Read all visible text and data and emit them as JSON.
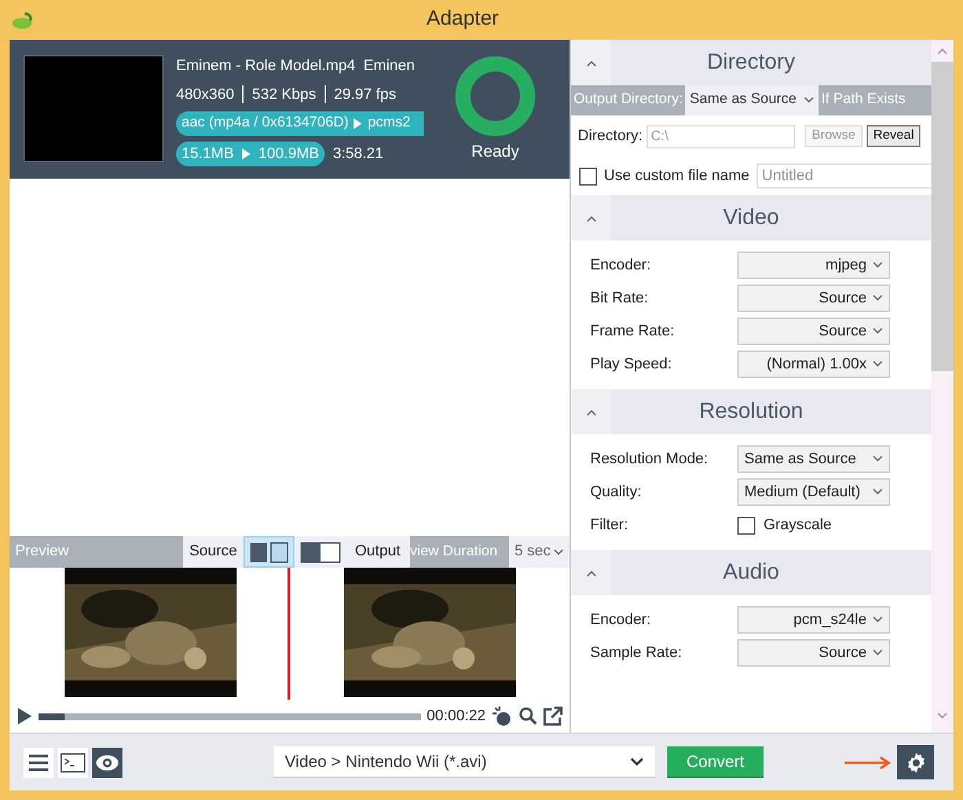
{
  "window": {
    "title": "Adapter"
  },
  "file": {
    "name": "Eminem - Role Model.mp4",
    "name_extra": "Eminen",
    "resolution": "480x360",
    "bitrate": "532 Kbps",
    "fps": "29.97 fps",
    "audio_in": "aac (mp4a / 0x6134706D)",
    "audio_out": "pcms2",
    "size_in": "15.1MB",
    "size_out": "100.9MB",
    "duration": "3:58.21",
    "status": "Ready"
  },
  "directory": {
    "title": "Directory",
    "expanded": true,
    "output_label": "Output Directory:",
    "output_value": "Same as Source",
    "path_exists_label": "If Path Exists",
    "dir_label": "Directory:",
    "dir_value": "C:\\",
    "browse": {
      "label": "Browse",
      "disabled": true
    },
    "reveal": {
      "label": "Reveal",
      "disabled": false
    },
    "custom_name": {
      "label": "Use custom file name",
      "checked": false,
      "placeholder": "Untitled"
    }
  },
  "sections": [
    {
      "title": "Video",
      "expanded": true,
      "rows": [
        {
          "kind": "select",
          "label": "Encoder:",
          "value": "mjpeg"
        },
        {
          "kind": "select",
          "label": "Bit Rate:",
          "value": "Source"
        },
        {
          "kind": "select",
          "label": "Frame Rate:",
          "value": "Source"
        },
        {
          "kind": "select",
          "label": "Play Speed:",
          "value": "(Normal) 1.00x"
        }
      ]
    },
    {
      "title": "Resolution",
      "expanded": true,
      "rows": [
        {
          "kind": "combo",
          "label": "Resolution Mode:",
          "value": "Same as Source"
        },
        {
          "kind": "combo",
          "label": "Quality:",
          "value": "Medium (Default)"
        },
        {
          "kind": "checkbox",
          "label": "Filter:",
          "value": "Grayscale",
          "checked": false
        }
      ]
    },
    {
      "title": "Audio",
      "expanded": true,
      "rows": [
        {
          "kind": "select",
          "label": "Encoder:",
          "value": "pcm_s24le"
        },
        {
          "kind": "select",
          "label": "Sample Rate:",
          "value": "Source"
        }
      ]
    }
  ],
  "preview": {
    "label": "Preview",
    "source_label": "Source",
    "view_modes": [
      {
        "kind": "split",
        "selected": true
      },
      {
        "kind": "side",
        "selected": false
      }
    ],
    "output_label": "Output",
    "duration_label": "view Duration",
    "duration_value": "5 sec",
    "level": 0.07,
    "time": "00:00:22"
  },
  "bottom": {
    "tools": [
      {
        "kind": "menu",
        "selected": false
      },
      {
        "kind": "console",
        "selected": false
      },
      {
        "kind": "eye",
        "selected": true
      }
    ],
    "preset": "Video > Nintendo Wii (*.avi)",
    "convert": "Convert"
  }
}
